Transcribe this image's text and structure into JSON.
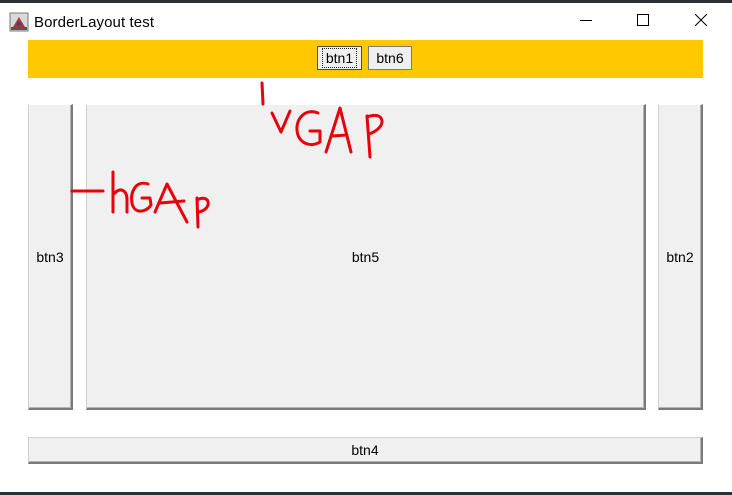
{
  "window": {
    "title": "BorderLayout test",
    "controls": {
      "minimize": "minimize-icon",
      "maximize": "maximize-icon",
      "close": "close-icon"
    }
  },
  "layout": {
    "north_buttons": [
      "btn1",
      "btn6"
    ],
    "west": "btn3",
    "center": "btn5",
    "east": "btn2",
    "south": "btn4"
  },
  "annotations": {
    "vgap_label": "VGAP",
    "hgap_label": "hGAp"
  },
  "colors": {
    "north_background": "#ffc800",
    "annotation_ink": "#e8000b",
    "button_face": "#f0f0f0"
  }
}
